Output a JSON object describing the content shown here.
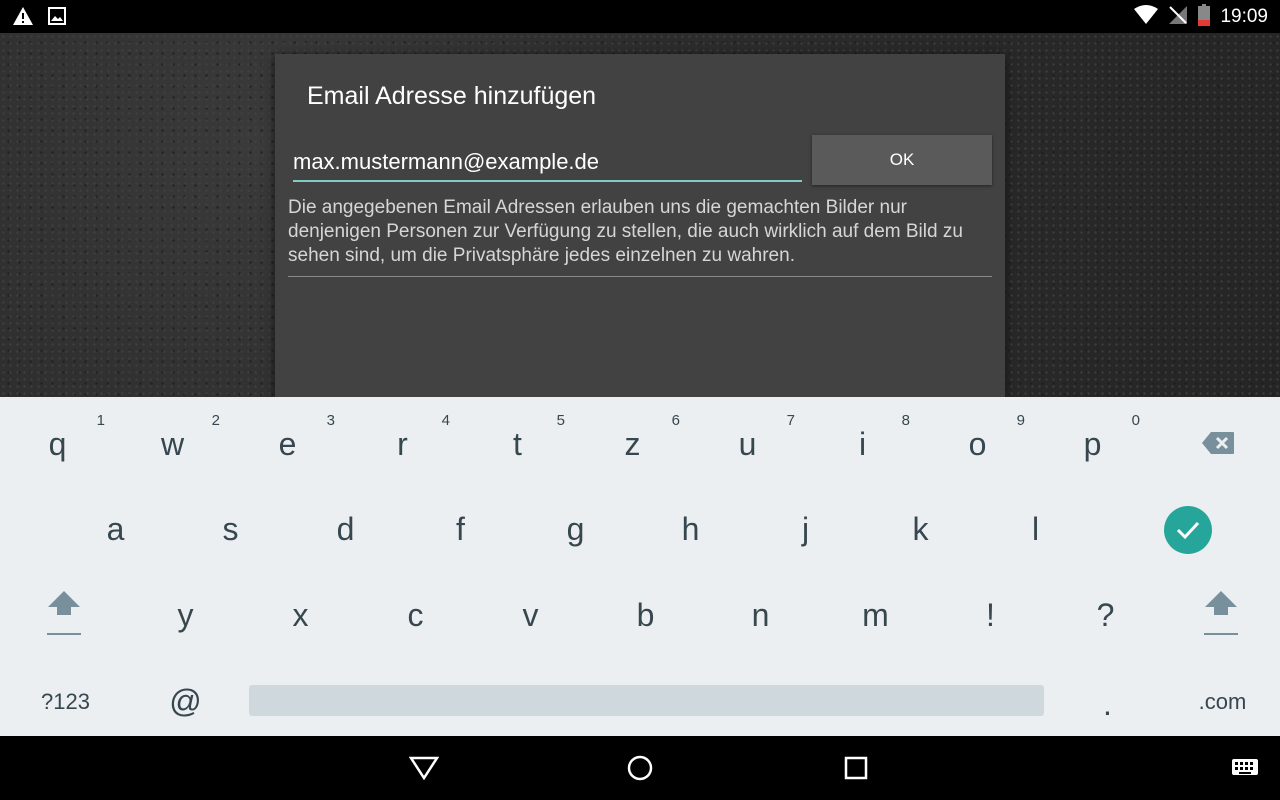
{
  "status_bar": {
    "time": "19:09",
    "icons": [
      "warning-icon",
      "image-notification-icon",
      "wifi-icon",
      "no-signal-icon",
      "battery-low-icon"
    ]
  },
  "dialog": {
    "title": "Email Adresse hinzufügen",
    "email_value": "max.mustermann@example.de",
    "ok_label": "OK",
    "description": "Die angegebenen Email Adressen erlauben uns die gemachten Bilder nur denjenigen Personen zur Verfügung zu stellen, die auch wirklich auf dem Bild zu sehen sind, um die Privatsphäre jedes einzelnen zu wahren."
  },
  "keyboard": {
    "row1": [
      {
        "key": "q",
        "hint": "1"
      },
      {
        "key": "w",
        "hint": "2"
      },
      {
        "key": "e",
        "hint": "3"
      },
      {
        "key": "r",
        "hint": "4"
      },
      {
        "key": "t",
        "hint": "5"
      },
      {
        "key": "z",
        "hint": "6"
      },
      {
        "key": "u",
        "hint": "7"
      },
      {
        "key": "i",
        "hint": "8"
      },
      {
        "key": "o",
        "hint": "9"
      },
      {
        "key": "p",
        "hint": "0"
      }
    ],
    "row2": [
      "a",
      "s",
      "d",
      "f",
      "g",
      "h",
      "j",
      "k",
      "l"
    ],
    "row3": [
      "y",
      "x",
      "c",
      "v",
      "b",
      "n",
      "m",
      "!",
      "?"
    ],
    "symbols_label": "?123",
    "at_label": "@",
    "period_label": ".",
    "dotcom_label": ".com",
    "accent_color": "#26a69a"
  },
  "nav_bar": {
    "buttons": [
      "back-icon",
      "home-icon",
      "recents-icon",
      "keyboard-icon"
    ]
  }
}
